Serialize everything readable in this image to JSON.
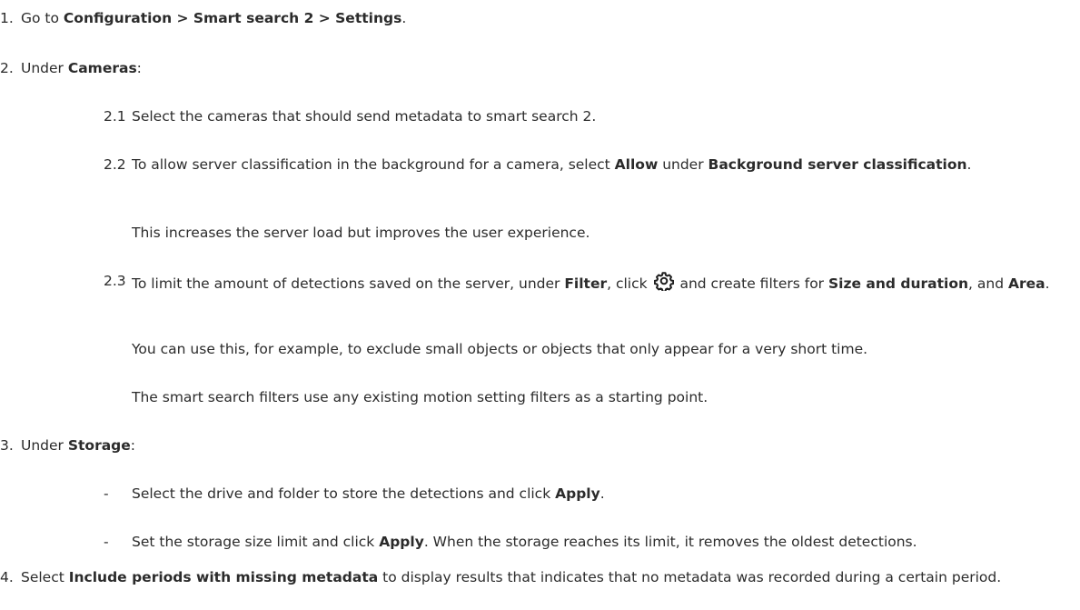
{
  "step1": {
    "num": "1.",
    "pre": "Go to ",
    "path": "Configuration > Smart search 2 > Settings",
    "post": "."
  },
  "step2": {
    "num": "2.",
    "pre": "Under ",
    "bold": "Cameras",
    "post": ":",
    "sub1": {
      "num": "2.1",
      "text": "Select the cameras that should send metadata to smart search 2."
    },
    "sub2": {
      "num": "2.2",
      "t1": "To allow server classification in the background for a camera, select ",
      "b1": "Allow",
      "t2": " under ",
      "b2": "Background server classification",
      "t3": ".",
      "note": "This increases the server load but improves the user experience."
    },
    "sub3": {
      "num": "2.3",
      "t1": "To limit the amount of detections saved on the server, under ",
      "b1": "Filter",
      "t2": ", click ",
      "icon": "gear-icon",
      "t3": " and create filters for ",
      "b2": "Size and duration",
      "t4": ", and ",
      "b3": "Area",
      "t5": ".",
      "note1": "You can use this, for example, to exclude small objects or objects that only appear for a very short time.",
      "note2": "The smart search filters use any existing motion setting filters as a starting point."
    }
  },
  "step3": {
    "num": "3.",
    "pre": "Under ",
    "bold": "Storage",
    "post": ":",
    "items": [
      {
        "dash": "-",
        "t1": "Select the drive and folder to store the detections and click ",
        "b1": "Apply",
        "t2": "."
      },
      {
        "dash": "-",
        "t1": "Set the storage size limit and click ",
        "b1": "Apply",
        "t2": ". When the storage reaches its limit, it removes the oldest detections."
      }
    ]
  },
  "step4": {
    "num": "4.",
    "pre": "Select ",
    "bold": "Include periods with missing metadata",
    "post": " to display results that indicates that no metadata was recorded during a certain period."
  }
}
